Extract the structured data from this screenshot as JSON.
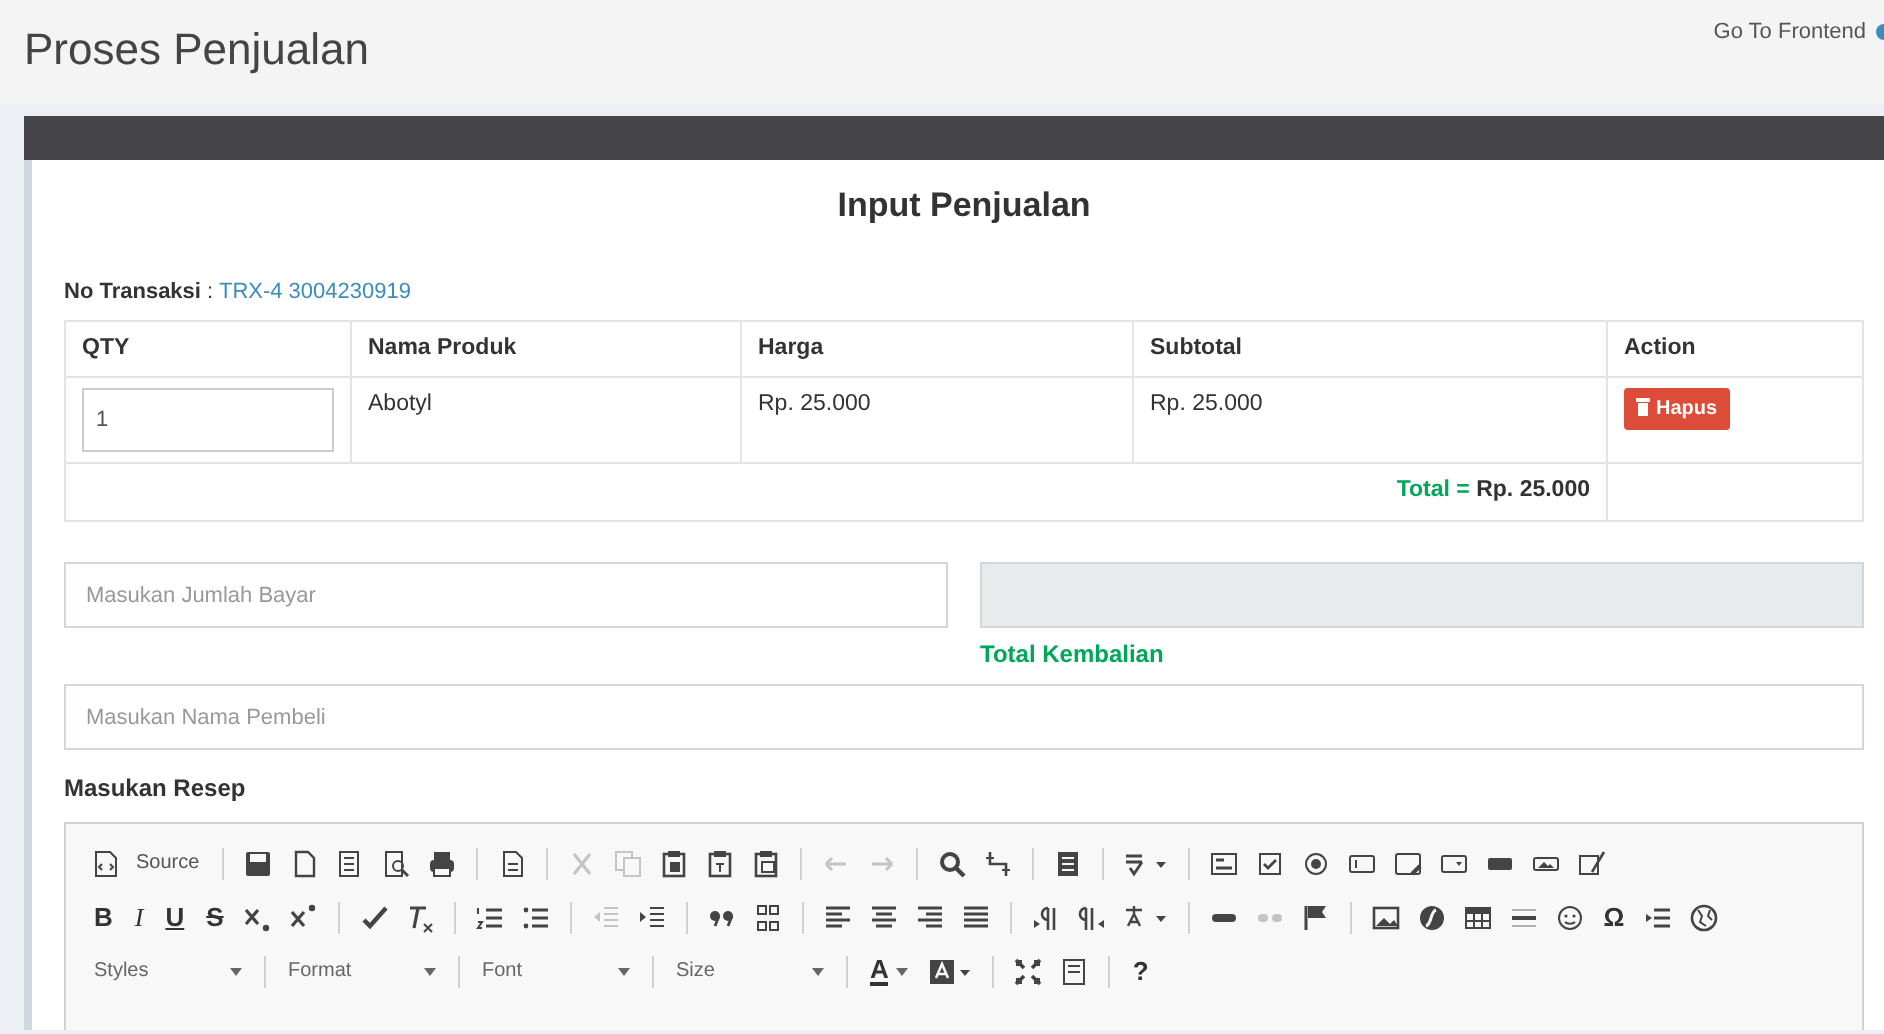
{
  "header": {
    "title": "Proses Penjualan",
    "link": "Go To Frontend"
  },
  "card": {
    "title": "Input Penjualan",
    "transaction_label": "No Transaksi",
    "transaction_separator": ":",
    "transaction_number": "TRX-4 3004230919"
  },
  "table": {
    "columns": [
      "QTY",
      "Nama Produk",
      "Harga",
      "Subtotal",
      "Action"
    ],
    "rows": [
      {
        "qty": "1",
        "product": "Abotyl",
        "price": "Rp. 25.000",
        "subtotal": "Rp. 25.000",
        "action": "Hapus"
      }
    ],
    "total_label": "Total =",
    "total_value": "Rp. 25.000"
  },
  "payment_field": {
    "placeholder": "Masukan Jumlah Bayar"
  },
  "change_field": {
    "disabled": true,
    "label": "Total Kembalian"
  },
  "buyer_field": {
    "placeholder": "Masukan Nama Pembeli"
  },
  "recipe": {
    "label": "Masukan Resep",
    "toolbar_rows": [
      [
        {
          "kind": "button",
          "label": "Source"
        }
      ],
      [
        {
          "kind": "bold",
          "label": "B"
        },
        {
          "kind": "italic",
          "label": "I"
        },
        {
          "kind": "underline",
          "label": "U"
        },
        {
          "kind": "strike",
          "label": "S"
        },
        {
          "kind": "button",
          "label": "Ω"
        }
      ],
      [
        {
          "kind": "combo",
          "label": "Styles"
        },
        {
          "kind": "combo",
          "label": "Format"
        },
        {
          "kind": "combo",
          "label": "Font"
        },
        {
          "kind": "combo",
          "label": "Size"
        },
        {
          "kind": "color",
          "label": "A"
        },
        {
          "kind": "button",
          "label": "?"
        }
      ]
    ]
  }
}
